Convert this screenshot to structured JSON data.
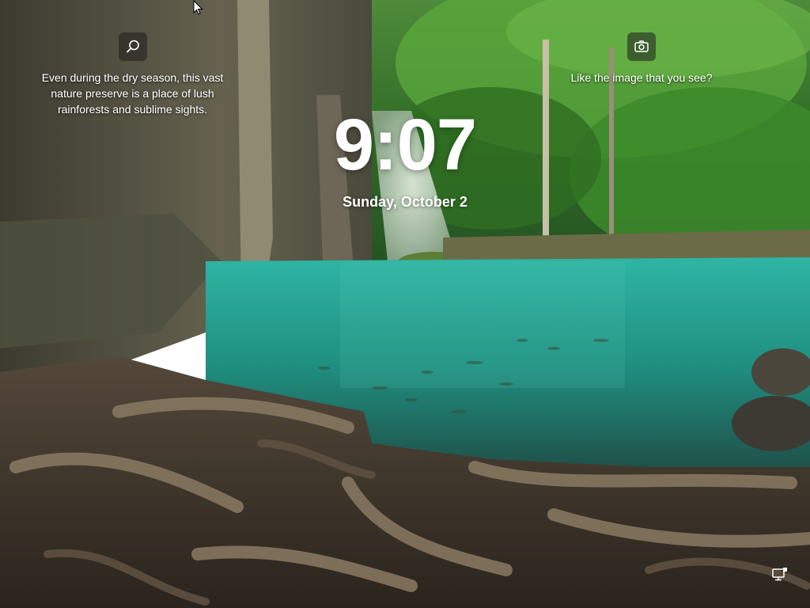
{
  "lock_screen": {
    "time": "9:07",
    "date": "Sunday, October 2"
  },
  "spotlight": {
    "search_icon": "search-icon",
    "camera_icon": "camera-icon",
    "description": "Even during the dry season, this vast nature preserve is a place of lush rainforests and sublime sights.",
    "like_prompt": "Like the image that you see?"
  },
  "tray": {
    "network_icon": "network-icon"
  },
  "colors": {
    "water": "#2aa596",
    "foliage": "#3f8a2c",
    "cliff": "#5d5a4a",
    "roots": "#6b5a48"
  }
}
